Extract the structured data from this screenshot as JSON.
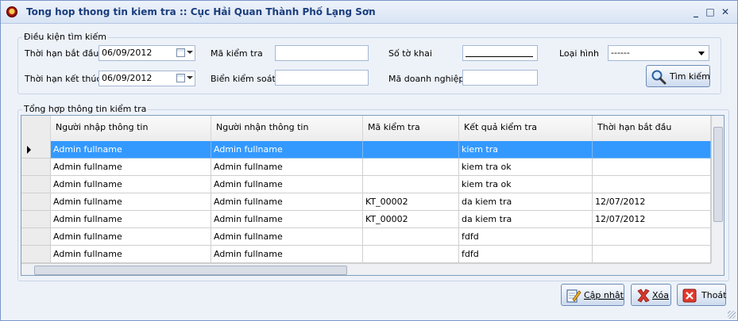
{
  "window": {
    "title": "Tong hop thong tin kiem tra :: Cục Hải Quan Thành Phố Lạng Sơn",
    "controls": {
      "minimize": "_",
      "maximize": "□",
      "close": "✕"
    }
  },
  "search": {
    "legend": "Điều kiện tìm kiếm",
    "from_date_label": "Thời hạn bắt đầu",
    "from_date_value": "06/09/2012",
    "to_date_label": "Thời hạn kết thúc",
    "to_date_value": "06/09/2012",
    "check_code_label": "Mã kiểm tra",
    "check_code_value": "",
    "plate_label": "Biển kiểm soát",
    "plate_value": "",
    "declaration_label": "Số tờ khai",
    "declaration_value": "",
    "company_code_label": "Mã doanh nghiệp",
    "company_code_value": "",
    "type_label": "Loại hình",
    "type_value": "------",
    "search_button": "Tìm kiếm"
  },
  "results": {
    "legend": "Tổng hợp thông tin kiểm tra",
    "columns": [
      "Người nhập thông tin",
      "Người nhận thông tin",
      "Mã kiểm tra",
      "Kết quả kiểm tra",
      "Thời hạn bắt đầu"
    ],
    "rows": [
      [
        "Admin fullname",
        "Admin fullname",
        "",
        "kiem tra",
        ""
      ],
      [
        "Admin fullname",
        "Admin fullname",
        "",
        "kiem tra ok",
        ""
      ],
      [
        "Admin fullname",
        "Admin fullname",
        "",
        "kiem tra ok",
        ""
      ],
      [
        "Admin fullname",
        "Admin fullname",
        "KT_00002",
        "da kiem tra",
        "12/07/2012"
      ],
      [
        "Admin fullname",
        "Admin fullname",
        "KT_00002",
        "da kiem tra",
        "12/07/2012"
      ],
      [
        "Admin fullname",
        "Admin fullname",
        "",
        "fdfd",
        ""
      ],
      [
        "Admin fullname",
        "Admin fullname",
        "",
        "fdfd",
        ""
      ]
    ],
    "selected_row": 0
  },
  "actions": {
    "update_button": "Cập nhật",
    "delete_button": "Xóa",
    "exit_button": "Thoát"
  },
  "icons": {
    "app": "customs-emblem-icon",
    "search": "magnifier-icon",
    "update": "edit-document-icon",
    "delete": "red-x-icon",
    "exit": "exit-x-icon"
  },
  "colors": {
    "selection": "#3399ff",
    "title_text": "#1a3d7c",
    "window_bg": "#edf2f9"
  }
}
